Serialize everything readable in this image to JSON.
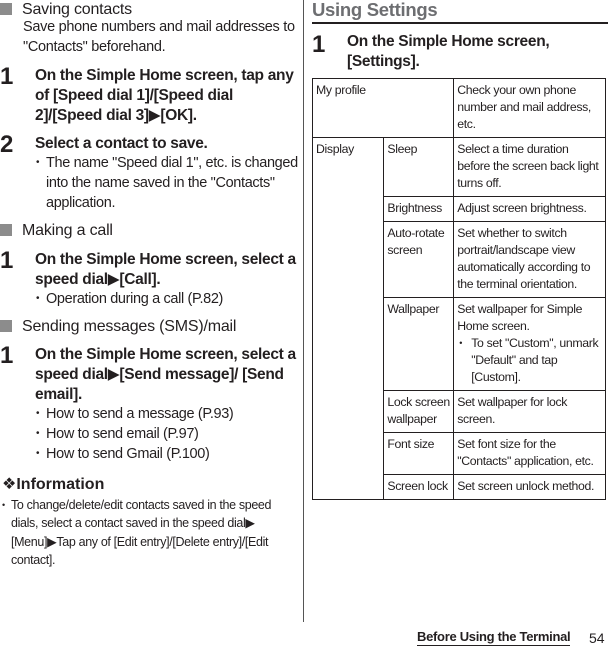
{
  "left": {
    "saving": {
      "heading": "Saving contacts",
      "description": "Save phone numbers and mail addresses to \"Contacts\" beforehand.",
      "steps": [
        {
          "num": "1",
          "text": "On the Simple Home screen, tap any of [Speed dial 1]/[Speed dial 2]/[Speed dial 3]▶[OK]."
        },
        {
          "num": "2",
          "text": "Select a contact to save."
        }
      ],
      "notes": [
        "The name \"Speed dial 1\", etc. is changed into the name saved in the \"Contacts\" application."
      ]
    },
    "call": {
      "heading": "Making a call",
      "steps": [
        {
          "num": "1",
          "text": "On the Simple Home screen, select a speed dial▶[Call]."
        }
      ],
      "notes": [
        "Operation during a call (P.82)"
      ]
    },
    "messages": {
      "heading": "Sending messages (SMS)/mail",
      "steps": [
        {
          "num": "1",
          "text": "On the Simple Home screen, select a speed dial▶[Send message]/ [Send email]."
        }
      ],
      "notes": [
        "How to send a message (P.93)",
        "How to send email (P.97)",
        "How to send Gmail (P.100)"
      ]
    },
    "information": {
      "heading": "❖Information",
      "text": "To change/delete/edit contacts saved in the speed dials, select a contact saved in the speed dial▶ [Menu]▶Tap any of [Edit entry]/[Delete entry]/[Edit contact]."
    }
  },
  "right": {
    "title": "Using Settings",
    "step": {
      "num": "1",
      "text": "On the Simple Home screen, [Settings]."
    },
    "table": {
      "my_profile": {
        "label": "My profile",
        "desc": "Check your own phone number and mail address, etc."
      },
      "display": {
        "label": "Display",
        "items": [
          {
            "label": "Sleep",
            "desc": "Select a time duration before the screen back light turns off."
          },
          {
            "label": "Brightness",
            "desc": "Adjust screen brightness."
          },
          {
            "label": "Auto-rotate screen",
            "desc": "Set whether to switch portrait/landscape view automatically according to the terminal orientation."
          },
          {
            "label": "Wallpaper",
            "desc": "Set wallpaper for Simple Home screen.",
            "note": "To set \"Custom\", unmark \"Default\" and tap [Custom]."
          },
          {
            "label": "Lock screen wallpaper",
            "desc": "Set wallpaper for lock screen."
          },
          {
            "label": "Font size",
            "desc": "Set font size for the \"Contacts\" application, etc."
          },
          {
            "label": "Screen lock",
            "desc": "Set screen unlock method."
          }
        ]
      }
    }
  },
  "footer": {
    "section": "Before Using the Terminal",
    "page": "54"
  }
}
